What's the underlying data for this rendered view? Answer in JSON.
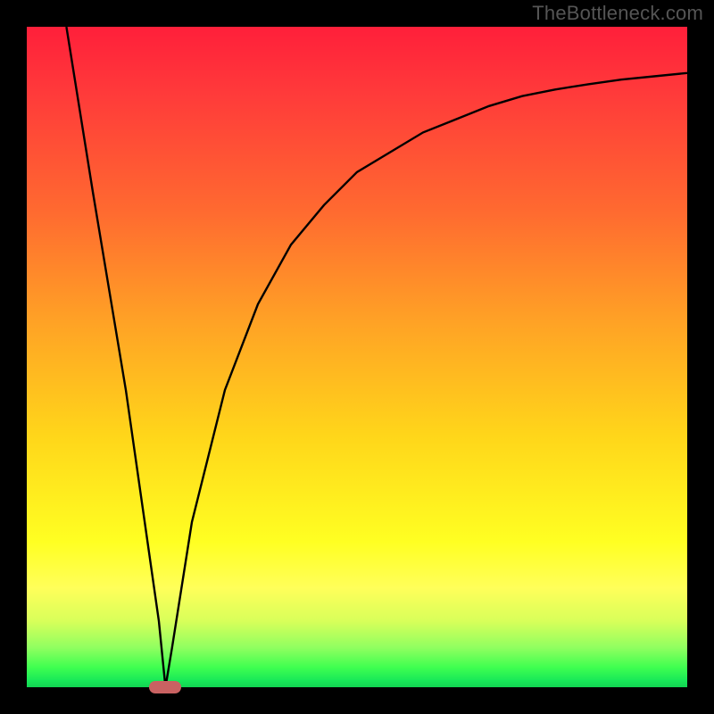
{
  "watermark": "TheBottleneck.com",
  "chart_data": {
    "type": "line",
    "title": "",
    "xlabel": "",
    "ylabel": "",
    "xlim": [
      0,
      100
    ],
    "ylim": [
      0,
      100
    ],
    "grid": false,
    "series": [
      {
        "name": "curve",
        "x": [
          6,
          10,
          15,
          20,
          21,
          22,
          25,
          30,
          35,
          40,
          45,
          50,
          55,
          60,
          65,
          70,
          75,
          80,
          85,
          90,
          95,
          100
        ],
        "y": [
          100,
          75,
          45,
          10,
          0,
          6,
          25,
          45,
          58,
          67,
          73,
          78,
          81,
          84,
          86,
          88,
          89.5,
          90.5,
          91.3,
          92,
          92.5,
          93
        ]
      }
    ],
    "marker": {
      "x": 21,
      "y": 0
    },
    "annotations": []
  },
  "colors": {
    "curve": "#000000",
    "marker": "#c96262",
    "gradient_top": "#ff1f3a",
    "gradient_bottom": "#12d452",
    "background": "#000000"
  }
}
